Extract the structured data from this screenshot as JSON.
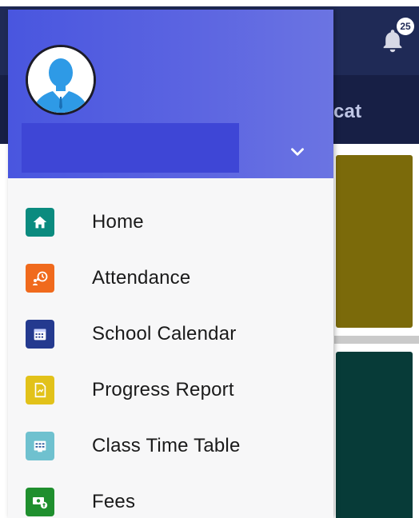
{
  "background": {
    "subbar_text": "cat",
    "notification_count": "25"
  },
  "drawer": {
    "user_name": "",
    "menu_items": [
      {
        "label": "Home",
        "icon": "home-icon",
        "color": "#0b8b7f"
      },
      {
        "label": "Attendance",
        "icon": "attendance-icon",
        "color": "#f06a1d"
      },
      {
        "label": "School Calendar",
        "icon": "calendar-icon",
        "color": "#243a8f"
      },
      {
        "label": "Progress Report",
        "icon": "report-icon",
        "color": "#e2c21a"
      },
      {
        "label": "Class Time Table",
        "icon": "timetable-icon",
        "color": "#6fc1cf"
      },
      {
        "label": "Fees",
        "icon": "fees-icon",
        "color": "#1f8f2e"
      }
    ]
  }
}
